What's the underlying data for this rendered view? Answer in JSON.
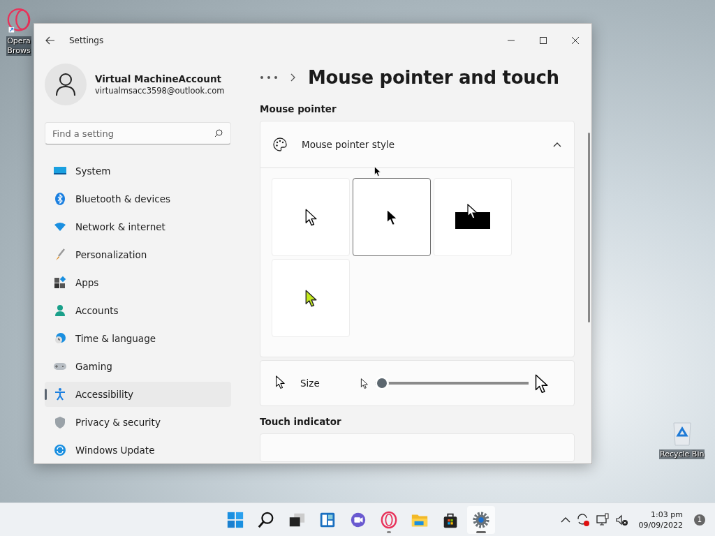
{
  "desktop_icons": [
    {
      "lines": [
        "Opera",
        "Brows"
      ]
    },
    {
      "lines": [
        "Recycle Bin"
      ]
    }
  ],
  "window": {
    "title": "Settings"
  },
  "profile": {
    "name": "Virtual MachineAccount",
    "email": "virtualmsacc3598@outlook.com"
  },
  "search": {
    "placeholder": "Find a setting"
  },
  "sidebar": {
    "items": [
      {
        "label": "System",
        "selected": false
      },
      {
        "label": "Bluetooth & devices",
        "selected": false
      },
      {
        "label": "Network & internet",
        "selected": false
      },
      {
        "label": "Personalization",
        "selected": false
      },
      {
        "label": "Apps",
        "selected": false
      },
      {
        "label": "Accounts",
        "selected": false
      },
      {
        "label": "Time & language",
        "selected": false
      },
      {
        "label": "Gaming",
        "selected": false
      },
      {
        "label": "Accessibility",
        "selected": true
      },
      {
        "label": "Privacy & security",
        "selected": false
      },
      {
        "label": "Windows Update",
        "selected": false
      }
    ]
  },
  "page": {
    "title": "Mouse pointer and touch",
    "sections": [
      {
        "heading": "Mouse pointer",
        "expander": {
          "label": "Mouse pointer style",
          "expanded": true,
          "options": [
            {
              "kind": "white",
              "selected": false
            },
            {
              "kind": "black",
              "selected": true
            },
            {
              "kind": "inverted",
              "selected": false
            },
            {
              "kind": "custom",
              "color": "#c3e81e",
              "selected": false
            }
          ]
        },
        "size": {
          "label": "Size",
          "level": 0
        }
      },
      {
        "heading": "Touch indicator"
      }
    ]
  },
  "taskbar": {
    "apps": [
      {
        "running": false,
        "selected": false
      },
      {
        "running": false,
        "selected": false
      },
      {
        "running": false,
        "selected": false
      },
      {
        "running": false,
        "selected": false
      },
      {
        "running": false,
        "selected": false
      },
      {
        "running": true,
        "selected": false
      },
      {
        "running": false,
        "selected": false
      },
      {
        "running": false,
        "selected": false
      },
      {
        "running": true,
        "selected": true
      }
    ],
    "time": "1:03 pm",
    "date": "09/09/2022",
    "notifications": "1"
  }
}
